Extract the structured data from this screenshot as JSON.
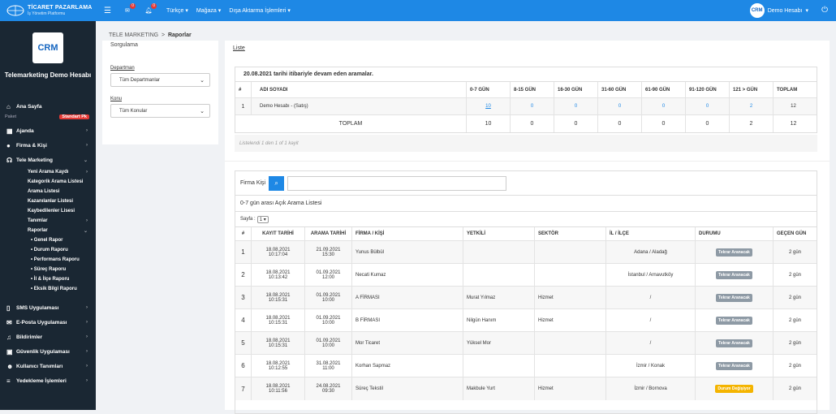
{
  "topbar": {
    "logo_title": "TİCARET PAZARLAMA",
    "logo_subtitle": "İş Yönetim Platformu",
    "messages_count": "0",
    "notifications_count": "0",
    "menus": [
      "Türkçe",
      "Mağaza",
      "Dışa Aktarma İşlemleri"
    ],
    "user_initials": "CRM",
    "user_name": "Demo Hesabı",
    "accent": "#1e88e5"
  },
  "sidebar": {
    "logo_text": "CRM",
    "company": "Telemarketing Demo Hesabı",
    "home": "Ana Sayfa",
    "paket_label": "Paket",
    "paket_badge": "Standart Pk",
    "items": [
      {
        "label": "Ajanda",
        "icon": "calendar-icon"
      },
      {
        "label": "Firma & Kişi",
        "icon": "user-icon"
      },
      {
        "label": "Tele Marketing",
        "icon": "headset-icon"
      }
    ],
    "tm_subs": [
      "Yeni Arama Kaydı",
      "Kategorik Arama Listesi",
      "Arama Listesi",
      "Kazanılanlar Listesi",
      "Kaybedilenler Lisesi",
      "Tanımlar",
      "Raporlar"
    ],
    "report_subs": [
      "Genel Rapor",
      "Durum Raporu",
      "Performans Raporu",
      "Süreç Raporu",
      "İl & İlçe Raporu",
      "Eksik Bilgi Raporu"
    ],
    "bottom": [
      {
        "label": "SMS Uygulaması",
        "icon": "mobile-icon"
      },
      {
        "label": "E-Posta Uygulaması",
        "icon": "mail-icon"
      },
      {
        "label": "Bildirimler",
        "icon": "bell-icon"
      },
      {
        "label": "Güvenlik Uygulaması",
        "icon": "lock-icon"
      },
      {
        "label": "Kullanıcı Tanımları",
        "icon": "users-icon"
      },
      {
        "label": "Yedekleme İşlemleri",
        "icon": "database-icon"
      }
    ]
  },
  "breadcrumb": {
    "parent": "TELE MARKETING",
    "sep": ">",
    "current": "Raporlar"
  },
  "filter": {
    "heading": "Sorgulama",
    "dept_label": "Departman",
    "dept_value": "Tüm Departmanlar",
    "topic_label": "Konu",
    "topic_value": "Tüm Konular"
  },
  "summary": {
    "link": "Liste",
    "caption": "20.08.2021 tarihi itibariyle devam eden aramalar.",
    "headers": [
      "#",
      "ADI SOYADI",
      "0-7 GÜN",
      "8-15 GÜN",
      "16-30 GÜN",
      "31-60 GÜN",
      "61-90 GÜN",
      "91-120 GÜN",
      "121 > GÜN",
      "TOPLAM"
    ],
    "row": {
      "num": "1",
      "name": "Demo Hesabı - (Satış)",
      "vals": [
        "10",
        "0",
        "0",
        "0",
        "0",
        "0",
        "2"
      ],
      "total": "12"
    },
    "total_label": "TOPLAM",
    "totals": [
      "10",
      "0",
      "0",
      "0",
      "0",
      "0",
      "2",
      "12"
    ],
    "footer": "Listelendi 1 den 1 of 1 kayit"
  },
  "calls": {
    "search_label": "Firma Kişi",
    "title": "0-7 gün arası Açık Arama Listesi",
    "page_label": "Sayfa :",
    "page_value": "1",
    "headers": [
      "#",
      "KAYIT TARİHİ",
      "ARAMA TARİHİ",
      "FİRMA / KİŞİ",
      "YETKİLİ",
      "SEKTÖR",
      "İL / İLÇE",
      "DURUMU",
      "GEÇEN GÜN"
    ],
    "rows": [
      {
        "n": "1",
        "kd": "18.08.2021",
        "kt": "10:17:04",
        "ad": "21.09.2021",
        "at": "15:30",
        "firm": "Yunus Bülbül",
        "yet": "",
        "sek": "",
        "il": "Adana / Aladağ",
        "dur": "Tekrar Aranacak",
        "durc": "#8e9aa5",
        "gg": "2 gün"
      },
      {
        "n": "2",
        "kd": "18.08.2021",
        "kt": "10:13:42",
        "ad": "01.09.2021",
        "at": "12:00",
        "firm": "Necati Kumaz",
        "yet": "",
        "sek": "",
        "il": "İstanbul / Arnavutköy",
        "dur": "Tekrar Aranacak",
        "durc": "#8e9aa5",
        "gg": "2 gün"
      },
      {
        "n": "3",
        "kd": "18.08.2021",
        "kt": "10:15:31",
        "ad": "01.09.2021",
        "at": "10:00",
        "firm": "A FİRMASI",
        "yet": "Murat Yılmaz",
        "sek": "Hizmet",
        "il": "/",
        "dur": "Tekrar Aranacak",
        "durc": "#8e9aa5",
        "gg": "2 gün"
      },
      {
        "n": "4",
        "kd": "18.08.2021",
        "kt": "10:15:31",
        "ad": "01.09.2021",
        "at": "10:00",
        "firm": "B FİRMASI",
        "yet": "Nilgün Hanım",
        "sek": "Hizmet",
        "il": "/",
        "dur": "Tekrar Aranacak",
        "durc": "#8e9aa5",
        "gg": "2 gün"
      },
      {
        "n": "5",
        "kd": "18.08.2021",
        "kt": "10:15:31",
        "ad": "01.09.2021",
        "at": "10:00",
        "firm": "Mor Ticaret",
        "yet": "Yüksel Mor",
        "sek": "",
        "il": "/",
        "dur": "Tekrar Aranacak",
        "durc": "#8e9aa5",
        "gg": "2 gün"
      },
      {
        "n": "6",
        "kd": "18.08.2021",
        "kt": "10:12:55",
        "ad": "31.08.2021",
        "at": "11:00",
        "firm": "Korhan Sapmaz",
        "yet": "",
        "sek": "",
        "il": "İzmir / Konak",
        "dur": "Tekrar Aranacak",
        "durc": "#8e9aa5",
        "gg": "2 gün"
      },
      {
        "n": "7",
        "kd": "18.08.2021",
        "kt": "10:11:56",
        "ad": "24.08.2021",
        "at": "09:30",
        "firm": "Süreç Tekstil",
        "yet": "Makbule Yurt",
        "sek": "Hizmet",
        "il": "İzmir / Bornova",
        "dur": "Durum Değişiyor",
        "durc": "#f4b400",
        "gg": "2 gün"
      }
    ]
  }
}
